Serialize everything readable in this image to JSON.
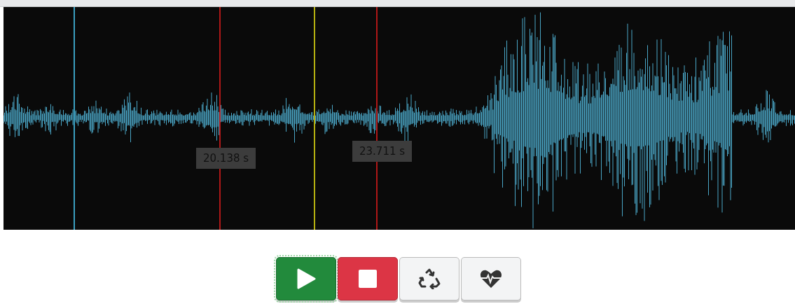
{
  "waveform": {
    "time_labels": [
      "20.138 s",
      "23.711 s"
    ]
  },
  "controls": [
    {
      "kind": "play",
      "focused": true
    },
    {
      "kind": "stop",
      "focused": false
    },
    {
      "kind": "loop",
      "focused": false
    },
    {
      "kind": "heart",
      "focused": false
    }
  ]
}
